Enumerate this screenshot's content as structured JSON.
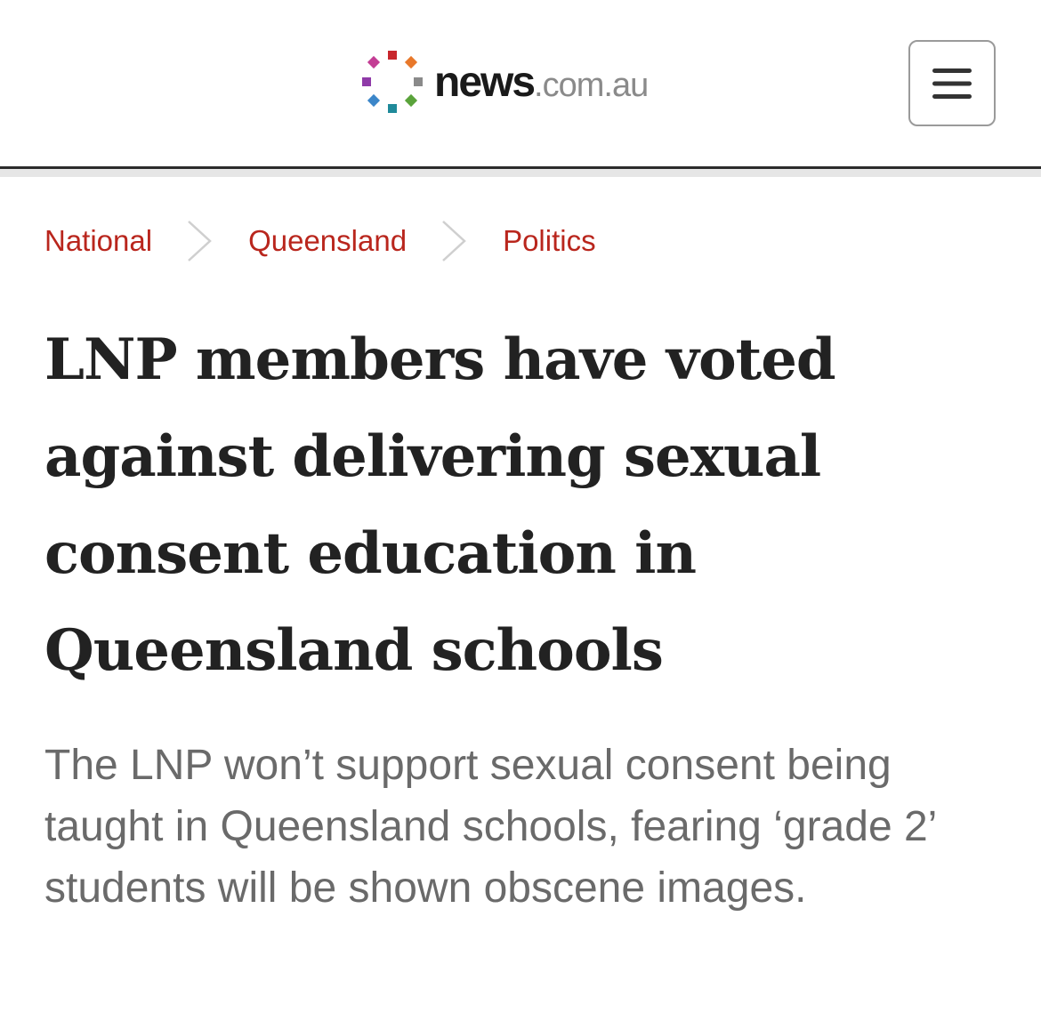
{
  "brand": {
    "name": "news",
    "domain": ".com.au",
    "dot_colors": [
      "#c8262c",
      "#e8782a",
      "#8a8a8a",
      "#5aa33b",
      "#1f8a9a",
      "#3b86c9",
      "#8f3aa8",
      "#c33d94"
    ]
  },
  "header": {
    "menu_icon": "hamburger-icon"
  },
  "breadcrumb": {
    "items": [
      {
        "label": "National"
      },
      {
        "label": "Queensland"
      },
      {
        "label": "Politics"
      }
    ],
    "separator_icon": "chevron-right-icon",
    "link_color": "#b9261d"
  },
  "article": {
    "headline": "LNP members have voted against delivering sexual consent education in Queensland schools",
    "standfirst": "The LNP won’t support sexual consent being taught in Queensland schools, fearing ‘grade 2’ students will be shown obscene images."
  }
}
